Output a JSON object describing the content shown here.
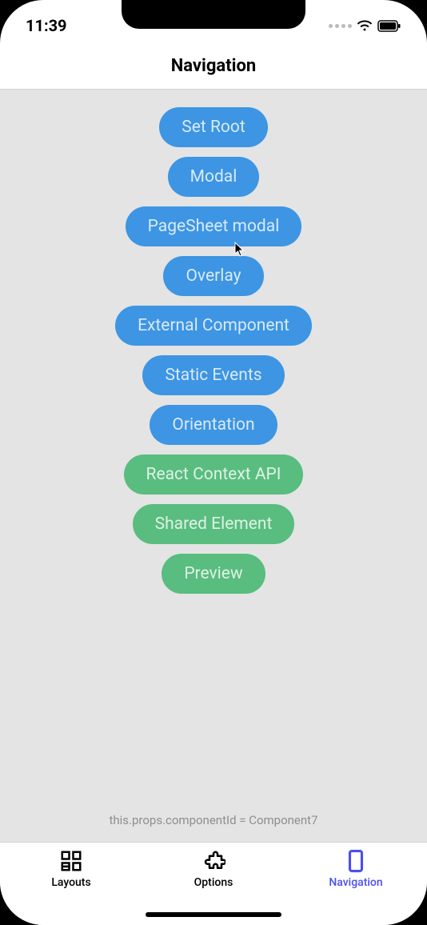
{
  "status_bar": {
    "time": "11:39"
  },
  "header": {
    "title": "Navigation"
  },
  "buttons": [
    {
      "label": "Set Root",
      "color": "blue"
    },
    {
      "label": "Modal",
      "color": "blue"
    },
    {
      "label": "PageSheet modal",
      "color": "blue"
    },
    {
      "label": "Overlay",
      "color": "blue"
    },
    {
      "label": "External Component",
      "color": "blue"
    },
    {
      "label": "Static Events",
      "color": "blue"
    },
    {
      "label": "Orientation",
      "color": "blue"
    },
    {
      "label": "React Context API",
      "color": "green"
    },
    {
      "label": "Shared Element",
      "color": "green"
    },
    {
      "label": "Preview",
      "color": "green"
    }
  ],
  "footer_text": "this.props.componentId = Component7",
  "tabs": [
    {
      "label": "Layouts",
      "icon": "layouts-icon",
      "active": false
    },
    {
      "label": "Options",
      "icon": "extension-icon",
      "active": false
    },
    {
      "label": "Navigation",
      "icon": "device-icon",
      "active": true
    }
  ]
}
